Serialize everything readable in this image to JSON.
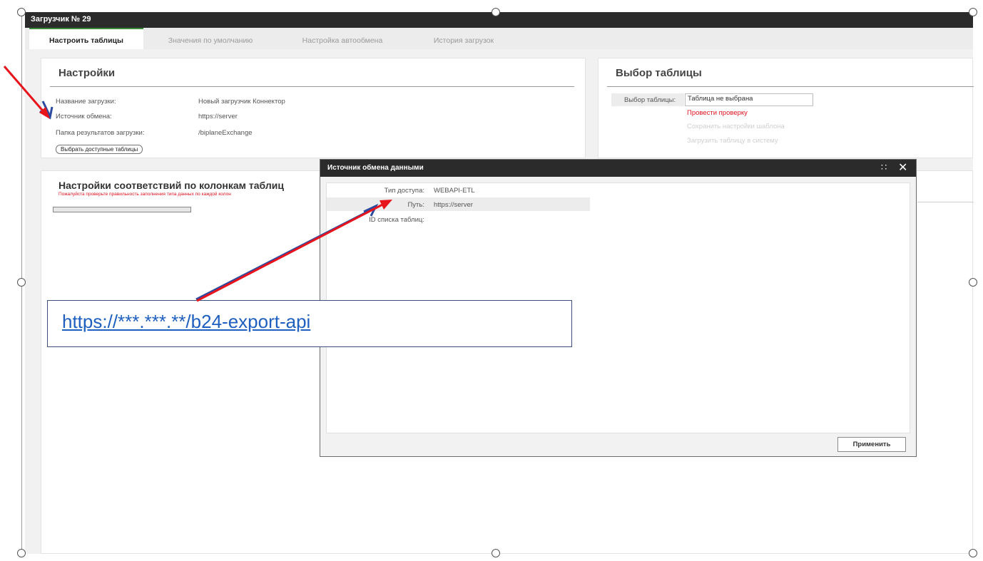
{
  "window": {
    "title": "Загрузчик № 29"
  },
  "tabs": [
    {
      "label": "Настроить таблицы"
    },
    {
      "label": "Значения по умолчанию"
    },
    {
      "label": "Настройка автообмена"
    },
    {
      "label": "История загрузок"
    }
  ],
  "settings": {
    "title": "Настройки",
    "rows": [
      {
        "label": "Название загрузки:",
        "value": "Новый загрузчик Коннектор"
      },
      {
        "label": "Источник обмена:",
        "value": "https://server"
      },
      {
        "label": "Папка результатов загрузки:",
        "value": "/biplaneExchange"
      }
    ],
    "button": "Выбрать доступные таблицы"
  },
  "table_select": {
    "title": "Выбор таблицы",
    "field_label": "Выбор таблицы:",
    "field_value": "Таблица не выбрана",
    "links": [
      "Провести проверку",
      "Сохранить настройки шаблона",
      "Загрузить таблицу в систему"
    ]
  },
  "mapping": {
    "title": "Настройки соответствий по колонкам таблиц",
    "warning": "Пожалуйста проверьте правильность заполнения типа данных по каждой колон"
  },
  "modal": {
    "title": "Источник обмена данными",
    "rows": [
      {
        "label": "Тип доступа:",
        "value": "WEBAPI-ETL"
      },
      {
        "label": "Путь:",
        "value": "https://server"
      },
      {
        "label": "ID списка таблиц:",
        "value": ""
      }
    ],
    "apply": "Применить"
  },
  "callout": {
    "text": "https://***.***.**/b24-export-api"
  },
  "colors": {
    "accent_green": "#3c8a3c",
    "warning_red": "#e0101e",
    "arrow_red": "#e8141c",
    "arrow_blue": "#2b4aa0",
    "link_blue": "#1f5fbf"
  },
  "icons": [
    "expand-icon",
    "close-icon"
  ]
}
